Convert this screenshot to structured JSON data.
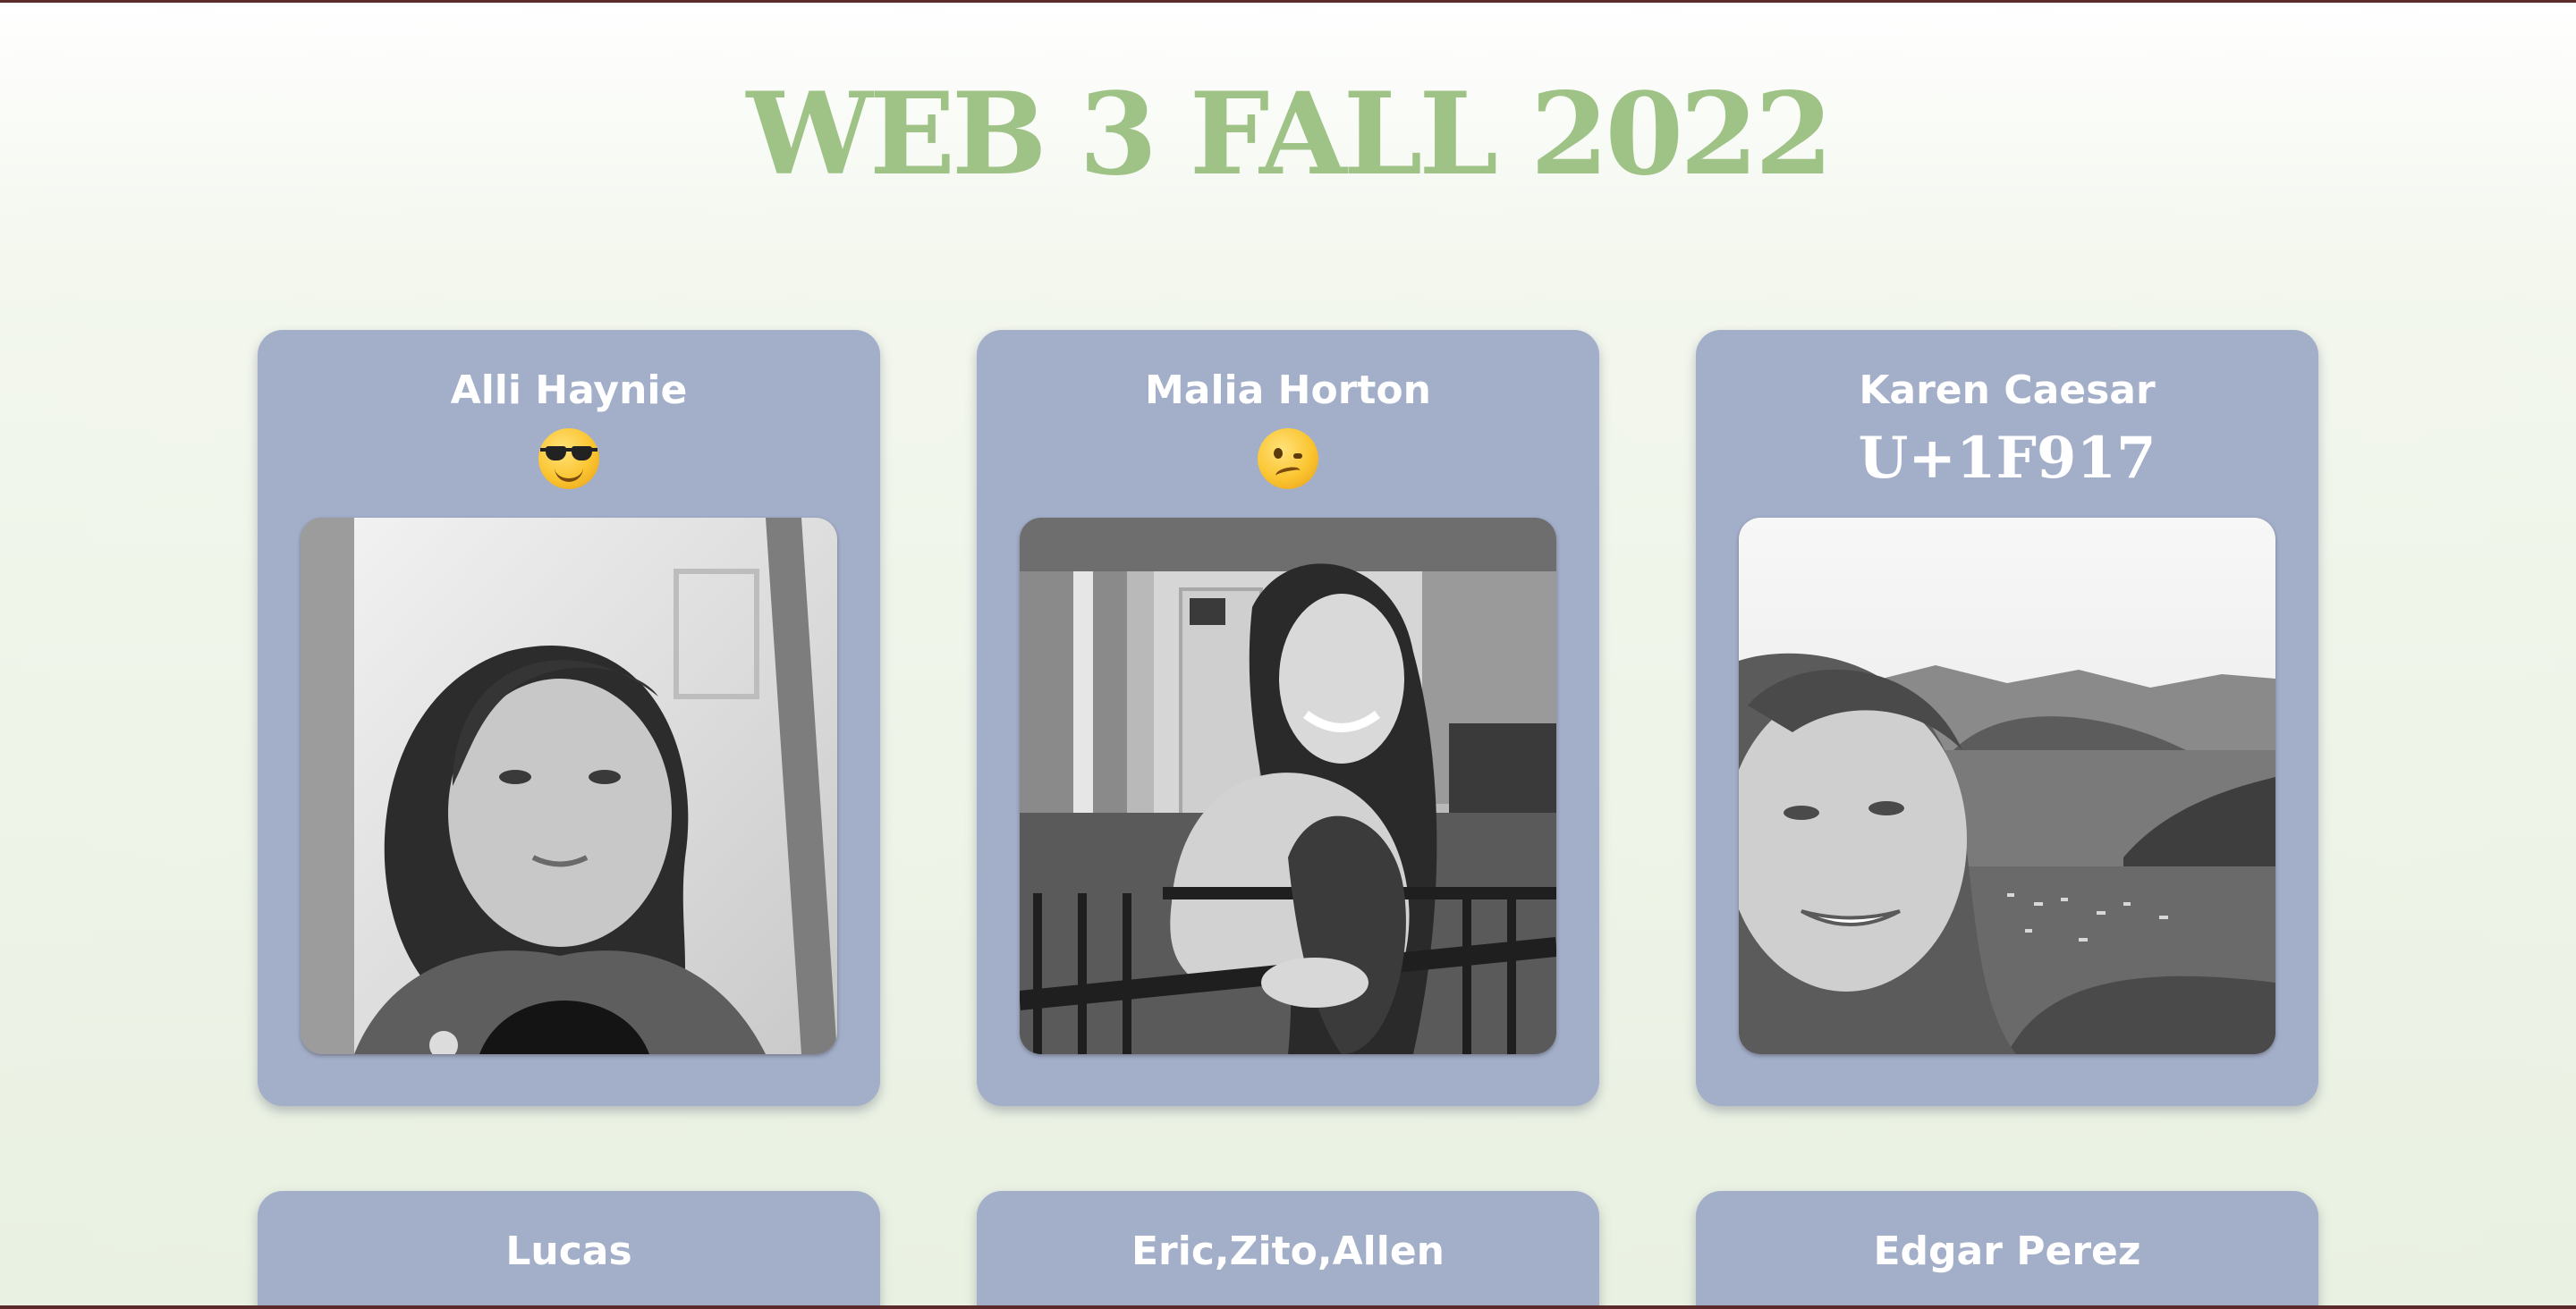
{
  "page": {
    "title": "WEB 3 FALL 2022"
  },
  "cards": [
    {
      "name": "Alli Haynie",
      "emoji_icon": "smiling-face-with-sunglasses-icon",
      "photo": "portrait-photo"
    },
    {
      "name": "Malia Horton",
      "emoji_icon": "woozy-face-icon",
      "photo": "portrait-photo"
    },
    {
      "name": "Karen Caesar",
      "emoji_text": "U+1F917",
      "photo": "landscape-selfie-photo"
    },
    {
      "name": "Lucas"
    },
    {
      "name": "Eric,Zito,Allen"
    },
    {
      "name": "Edgar Perez"
    }
  ],
  "colors": {
    "title": "#9fc386",
    "card": "#a3aec9",
    "card_text": "#ffffff",
    "border": "#5b2a2a"
  }
}
